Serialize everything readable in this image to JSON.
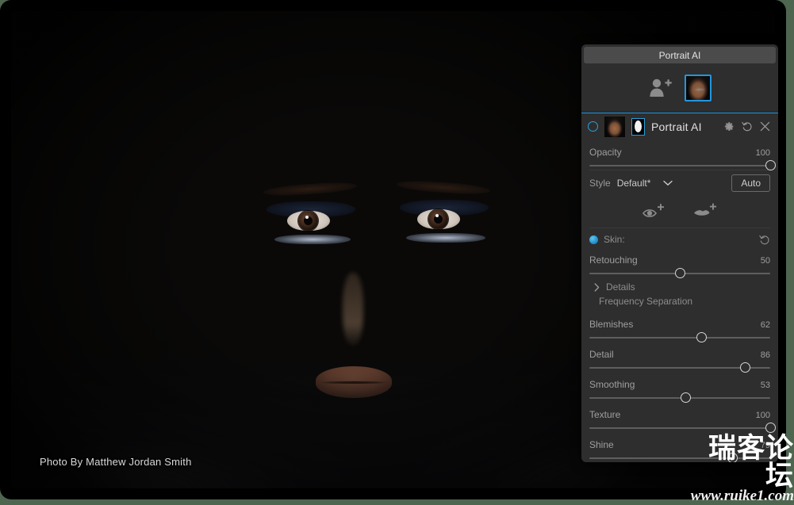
{
  "window": {
    "photo_credit": "Photo By Matthew Jordan Smith"
  },
  "panel": {
    "title": "Portrait AI",
    "faces": {
      "add_face_icon": "add-person-icon",
      "selected_face_label": "face-thumbnail"
    },
    "layer": {
      "name": "Portrait AI",
      "visibility_icon": "radio-circle-icon",
      "thumbnail_icon": "layer-thumbnail",
      "mask_icon": "layer-mask-thumbnail",
      "settings_icon": "gear-icon",
      "reset_icon": "undo-icon",
      "close_icon": "close-icon"
    },
    "opacity": {
      "label": "Opacity",
      "value": "100",
      "percent": 100
    },
    "style": {
      "label": "Style",
      "value": "Default*",
      "chevron": "chevron-down-icon",
      "auto_label": "Auto"
    },
    "tools": [
      {
        "name": "add-eye-icon"
      },
      {
        "name": "add-lips-icon"
      }
    ],
    "skin": {
      "label": "Skin:",
      "dot_color": "#2b9ad6",
      "reset_icon": "undo-icon"
    },
    "details": {
      "label": "Details",
      "caret": "chevron-right-icon",
      "sub_label": "Frequency Separation"
    },
    "sliders": [
      {
        "label": "Retouching",
        "value": "50",
        "percent": 50
      },
      {
        "label": "Blemishes",
        "value": "62",
        "percent": 62
      },
      {
        "label": "Detail",
        "value": "86",
        "percent": 86
      },
      {
        "label": "Smoothing",
        "value": "53",
        "percent": 53
      },
      {
        "label": "Texture",
        "value": "100",
        "percent": 100
      },
      {
        "label": "Shine",
        "value": "79",
        "percent": 79
      }
    ]
  },
  "watermark": {
    "brand": "瑞客论坛",
    "url": "www.ruike1.com"
  },
  "colors": {
    "accent": "#2196e0",
    "panel_bg": "#2e2e2e",
    "title_bg": "#4b4b4b",
    "desktop_bg": "#4e6650"
  }
}
